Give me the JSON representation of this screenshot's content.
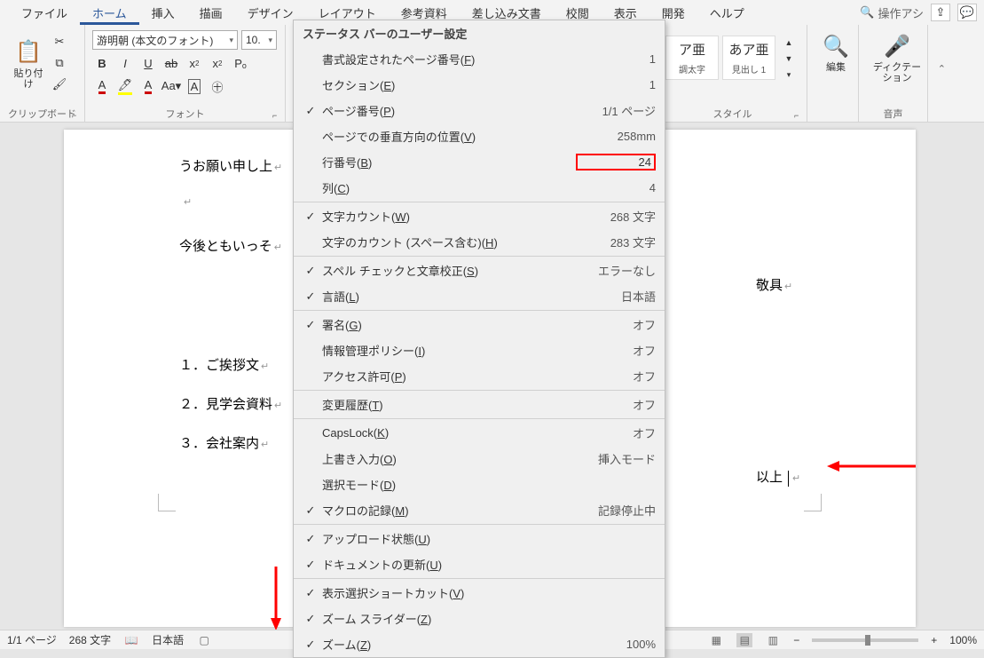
{
  "menubar": {
    "items": [
      "ファイル",
      "ホーム",
      "挿入",
      "描画",
      "デザイン",
      "レイアウト",
      "参考資料",
      "差し込み文書",
      "校閲",
      "表示",
      "開発",
      "ヘルプ"
    ],
    "active_index": 1,
    "search_placeholder": "操作アシ"
  },
  "ribbon": {
    "clipboard": {
      "paste_label": "貼り付け",
      "group_label": "クリップボード"
    },
    "font": {
      "font_name": "游明朝 (本文のフォント)",
      "font_size": "10.",
      "group_label": "フォント"
    },
    "styles": {
      "group_label": "スタイル",
      "items": [
        {
          "preview": "ア亜",
          "name": "調太字"
        },
        {
          "preview": "あア亜",
          "name": "見出し 1"
        }
      ]
    },
    "editing": {
      "label": "編集"
    },
    "dictation": {
      "label": "ディクテーション",
      "group_label": "音声"
    }
  },
  "context_menu": {
    "title": "ステータス バーのユーザー設定",
    "items": [
      {
        "checked": false,
        "label": "書式設定されたページ番号",
        "accel": "F",
        "value": "1",
        "sep_after": false
      },
      {
        "checked": false,
        "label": "セクション",
        "accel": "E",
        "value": "1",
        "sep_after": false
      },
      {
        "checked": true,
        "label": "ページ番号",
        "accel": "P",
        "value": "1/1 ページ",
        "sep_after": false
      },
      {
        "checked": false,
        "label": "ページでの垂直方向の位置",
        "accel": "V",
        "value": "258mm",
        "sep_after": false
      },
      {
        "checked": false,
        "label": "行番号",
        "accel": "B",
        "value": "24",
        "highlighted": true,
        "sep_after": false
      },
      {
        "checked": false,
        "label": "列",
        "accel": "C",
        "value": "4",
        "sep_after": true
      },
      {
        "checked": true,
        "label": "文字カウント",
        "accel": "W",
        "value": "268 文字",
        "sep_after": false
      },
      {
        "checked": false,
        "label": "文字のカウント (スペース含む)",
        "accel": "H",
        "value": "283 文字",
        "sep_after": true
      },
      {
        "checked": true,
        "label": "スペル チェックと文章校正",
        "accel": "S",
        "value": "エラーなし",
        "sep_after": false
      },
      {
        "checked": true,
        "label": "言語",
        "accel": "L",
        "value": "日本語",
        "sep_after": true
      },
      {
        "checked": true,
        "label": "署名",
        "accel": "G",
        "value": "オフ",
        "sep_after": false
      },
      {
        "checked": false,
        "label": "情報管理ポリシー",
        "accel": "I",
        "value": "オフ",
        "sep_after": false
      },
      {
        "checked": false,
        "label": "アクセス許可",
        "accel": "P",
        "value": "オフ",
        "sep_after": true
      },
      {
        "checked": false,
        "label": "変更履歴",
        "accel": "T",
        "value": "オフ",
        "sep_after": true
      },
      {
        "checked": false,
        "label": "CapsLock",
        "accel": "K",
        "value": "オフ",
        "sep_after": false
      },
      {
        "checked": false,
        "label": "上書き入力",
        "accel": "O",
        "value": "挿入モード",
        "sep_after": false
      },
      {
        "checked": false,
        "label": "選択モード",
        "accel": "D",
        "value": "",
        "sep_after": false
      },
      {
        "checked": true,
        "label": "マクロの記録",
        "accel": "M",
        "value": "記録停止中",
        "sep_after": true
      },
      {
        "checked": true,
        "label": "アップロード状態",
        "accel": "U",
        "value": "",
        "sep_after": false
      },
      {
        "checked": true,
        "label": "ドキュメントの更新",
        "accel": "U",
        "value": "",
        "sep_after": true
      },
      {
        "checked": true,
        "label": "表示選択ショートカット",
        "accel": "V",
        "value": "",
        "sep_after": false
      },
      {
        "checked": true,
        "label": "ズーム スライダー",
        "accel": "Z",
        "value": "",
        "sep_after": false
      },
      {
        "checked": true,
        "label": "ズーム",
        "accel": "Z",
        "value": "100%",
        "sep_after": false
      }
    ]
  },
  "document": {
    "lines": {
      "l1": "うお願い申し上",
      "l2": "今後ともいっそ",
      "l3": "敬具",
      "l4": "１．ご挨拶文",
      "l5": "２．見学会資料",
      "l6": "３．会社案内",
      "l7": "以上"
    }
  },
  "statusbar": {
    "page": "1/1 ページ",
    "words": "268 文字",
    "language": "日本語",
    "zoom": "100%"
  }
}
